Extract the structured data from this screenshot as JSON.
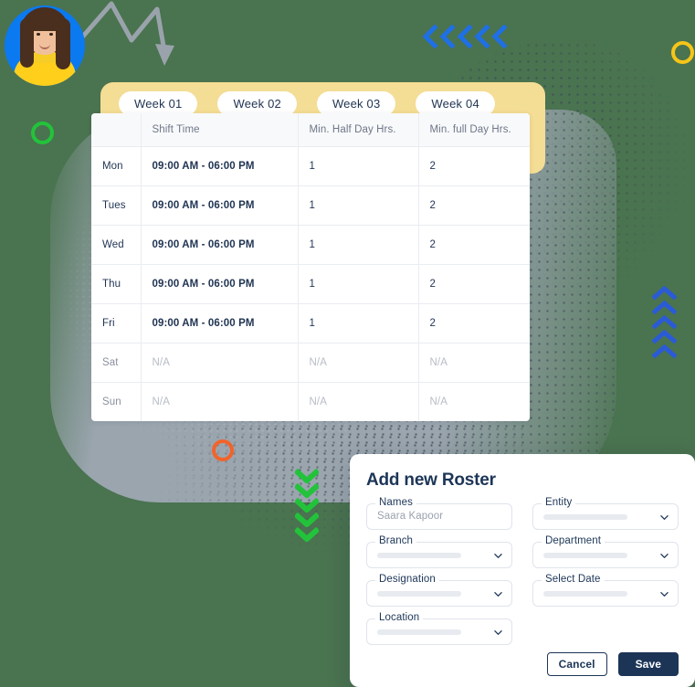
{
  "colors": {
    "background_green": "#4a7350",
    "tabbar_yellow": "#f4dd94",
    "gray_plate": "#9aa5ae",
    "navy": "#1c3557",
    "accent_blue": "#1f6fe5",
    "accent_green": "#22c33a",
    "accent_yellow": "#f5c518",
    "accent_orange": "#f2632a"
  },
  "avatar": {
    "name": "user-avatar"
  },
  "decorations": {
    "zigzag_arrow": "zigzag-arrow-icon",
    "ring_green": "green-circle-marker",
    "ring_yellow": "yellow-circle-marker",
    "ring_orange": "orange-circle-marker",
    "chevrons_left": {
      "icon": "chevron-left-icon",
      "count": 5,
      "color": "#1f6fe5"
    },
    "chevrons_up": {
      "icon": "chevron-up-icon",
      "count": 5,
      "color": "#2a5bd7"
    },
    "chevrons_down": {
      "icon": "chevron-down-icon",
      "count": 5,
      "color": "#22c33a"
    }
  },
  "week_tabs": [
    {
      "label": "Week 01"
    },
    {
      "label": "Week 02"
    },
    {
      "label": "Week 03"
    },
    {
      "label": "Week 04"
    }
  ],
  "roster_table": {
    "columns": [
      "",
      "Shift Time",
      "Min. Half Day Hrs.",
      "Min. full Day Hrs."
    ],
    "rows": [
      {
        "day": "Mon",
        "shift": "09:00 AM - 06:00 PM",
        "half": "1",
        "full": "2",
        "off": false
      },
      {
        "day": "Tues",
        "shift": "09:00 AM - 06:00 PM",
        "half": "1",
        "full": "2",
        "off": false
      },
      {
        "day": "Wed",
        "shift": "09:00 AM - 06:00 PM",
        "half": "1",
        "full": "2",
        "off": false
      },
      {
        "day": "Thu",
        "shift": "09:00 AM - 06:00 PM",
        "half": "1",
        "full": "2",
        "off": false
      },
      {
        "day": "Fri",
        "shift": "09:00 AM - 06:00 PM",
        "half": "1",
        "full": "2",
        "off": false
      },
      {
        "day": "Sat",
        "shift": "N/A",
        "half": "N/A",
        "full": "N/A",
        "off": true
      },
      {
        "day": "Sun",
        "shift": "N/A",
        "half": "N/A",
        "full": "N/A",
        "off": true
      }
    ]
  },
  "roster_panel": {
    "title": "Add new Roster",
    "fields": [
      {
        "label": "Names",
        "value": "Saara Kapoor",
        "type": "text"
      },
      {
        "label": "Entity",
        "value": "",
        "type": "select"
      },
      {
        "label": "Branch",
        "value": "",
        "type": "select"
      },
      {
        "label": "Department",
        "value": "",
        "type": "select"
      },
      {
        "label": "Designation",
        "value": "",
        "type": "select"
      },
      {
        "label": "Select Date",
        "value": "",
        "type": "select"
      },
      {
        "label": "Location",
        "value": "",
        "type": "select"
      }
    ],
    "cancel_label": "Cancel",
    "save_label": "Save"
  }
}
